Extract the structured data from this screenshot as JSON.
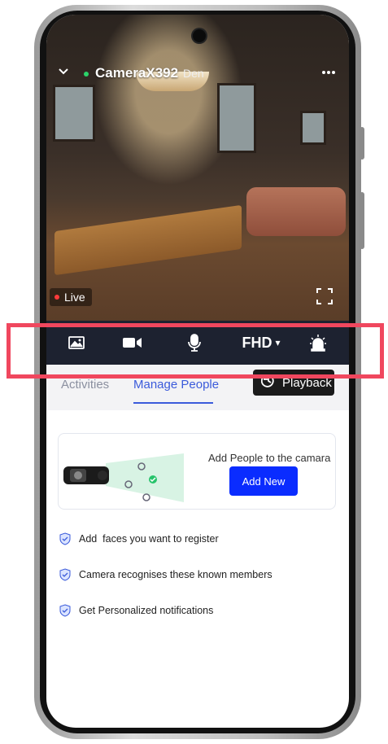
{
  "camera": {
    "name": "CameraX392",
    "separator": "·",
    "room": "Den",
    "live_label": "Live",
    "status_color": "#2bd46a"
  },
  "icons": {
    "back": "chevron-down-icon",
    "more": "more-horizontal-icon",
    "fullscreen": "fullscreen-icon",
    "snapshot": "image-icon",
    "record": "video-camera-icon",
    "talk": "microphone-icon",
    "siren": "siren-icon",
    "playback": "history-icon",
    "check": "shield-check-icon"
  },
  "controls": {
    "quality_label": "FHD",
    "quality_arrow": "▾"
  },
  "tabs": [
    {
      "label": "Activities",
      "active": false
    },
    {
      "label": "Manage People",
      "active": true
    }
  ],
  "playback_label": "Playback",
  "card": {
    "title": "Add People to the camara",
    "button_label": "Add New"
  },
  "features": [
    "Add  faces you want to register",
    "Camera recognises these known members",
    "Get Personalized notifications"
  ],
  "colors": {
    "accent": "#3b5bdb",
    "primary_button": "#0a2cff",
    "control_bar": "#1d2230",
    "highlight": "#f0475e",
    "live_dot": "#ff3b3b"
  }
}
